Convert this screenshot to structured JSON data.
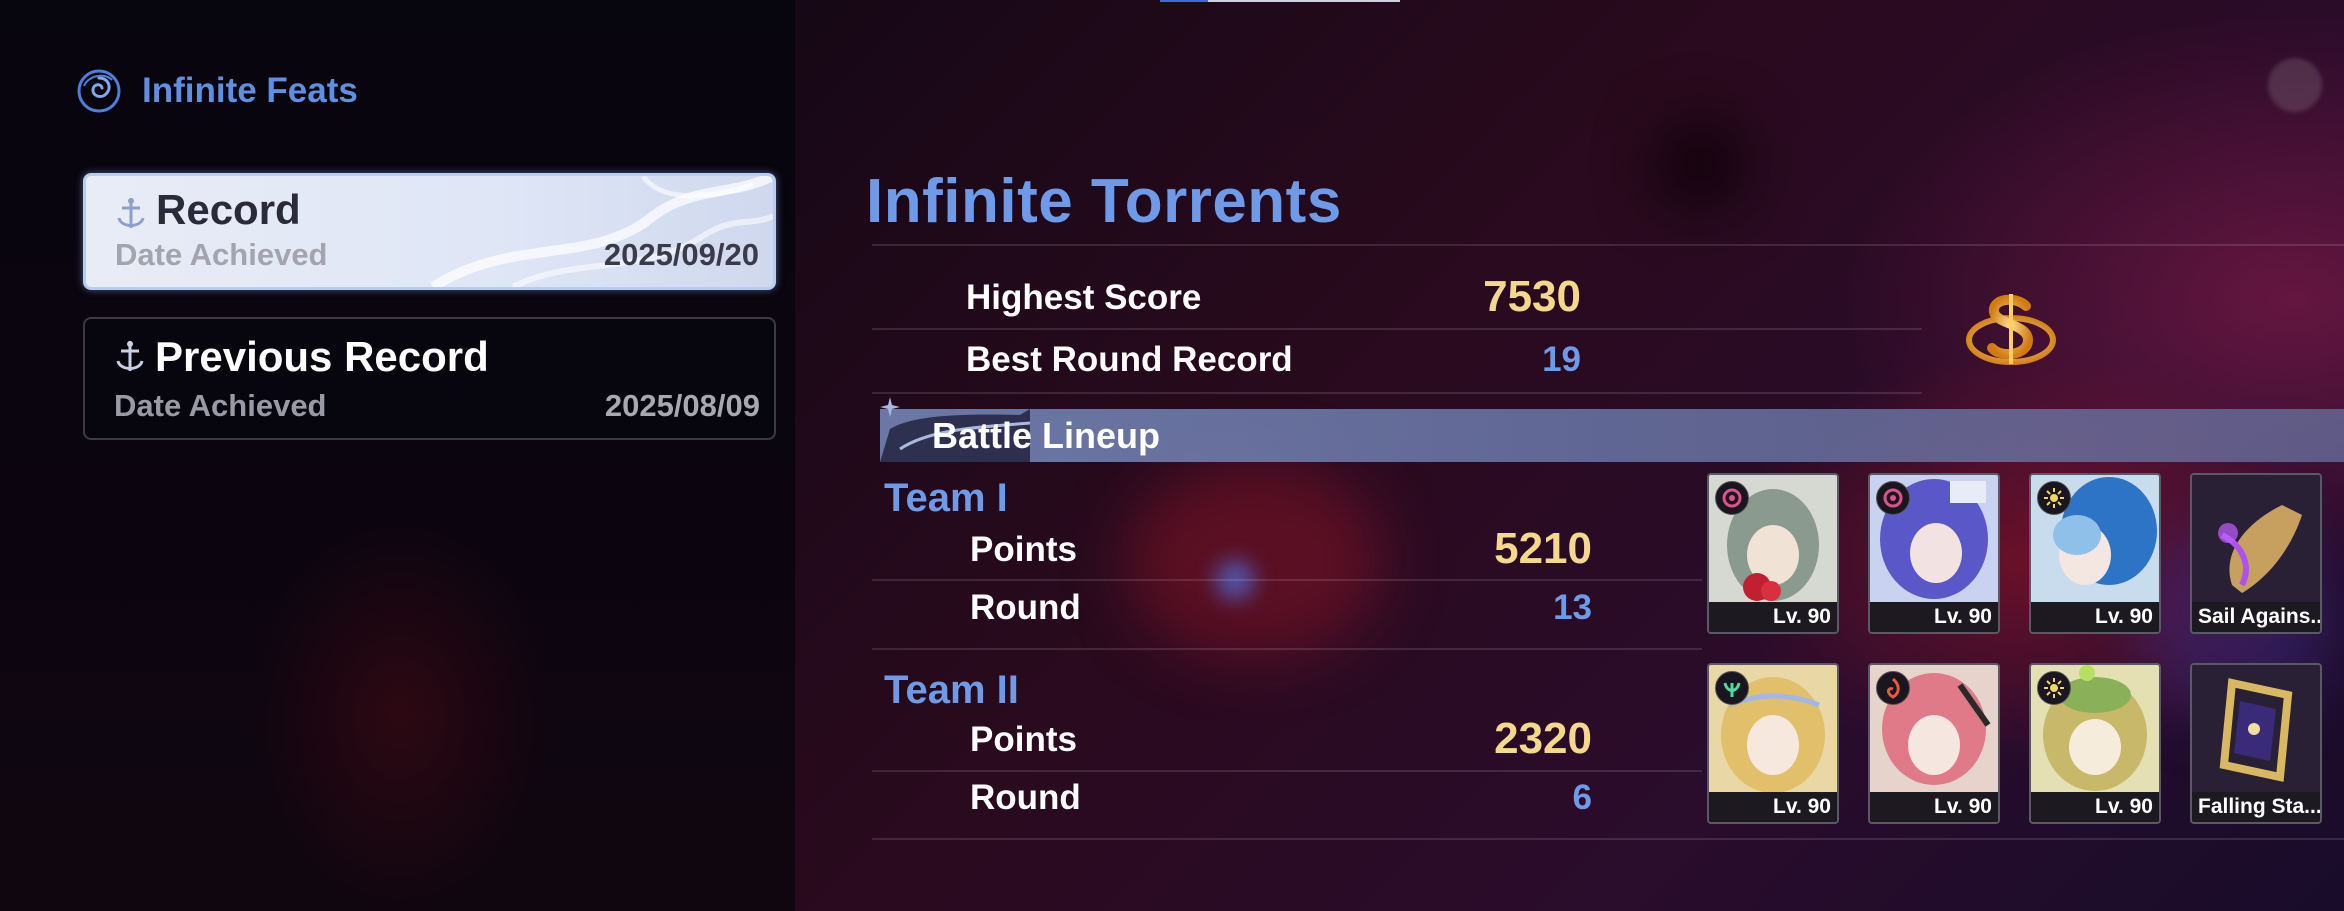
{
  "header": {
    "title": "Infinite Feats",
    "icon": "spiral-icon"
  },
  "records": [
    {
      "title": "Record",
      "label": "Date Achieved",
      "date": "2025/09/20",
      "selected": true
    },
    {
      "title": "Previous Record",
      "label": "Date Achieved",
      "date": "2025/08/09",
      "selected": false
    }
  ],
  "main": {
    "title": "Infinite Torrents",
    "highest_score_label": "Highest Score",
    "highest_score": "7530",
    "best_round_label": "Best Round Record",
    "best_round": "19",
    "lineup_title": "Battle Lineup"
  },
  "teams": [
    {
      "name": "Team I",
      "points_label": "Points",
      "points": "5210",
      "round_label": "Round",
      "round": "13",
      "slots": [
        {
          "footer": "Lv. 90",
          "element": "fusion",
          "element_color": "#e0508c"
        },
        {
          "footer": "Lv. 90",
          "element": "fusion",
          "element_color": "#e0508c"
        },
        {
          "footer": "Lv. 90",
          "element": "spectro",
          "element_color": "#f0d860"
        },
        {
          "footer": "Sail Agains...",
          "element": "weapon"
        }
      ]
    },
    {
      "name": "Team II",
      "points_label": "Points",
      "points": "2320",
      "round_label": "Round",
      "round": "6",
      "slots": [
        {
          "footer": "Lv. 90",
          "element": "aero",
          "element_color": "#4fd8a0"
        },
        {
          "footer": "Lv. 90",
          "element": "fusion",
          "element_color": "#e85a3a"
        },
        {
          "footer": "Lv. 90",
          "element": "spectro",
          "element_color": "#f0d860"
        },
        {
          "footer": "Falling Sta...",
          "element": "weapon"
        }
      ]
    }
  ],
  "colors": {
    "accent_blue": "#6f9ae8",
    "score_gold": "#f4d98c"
  }
}
